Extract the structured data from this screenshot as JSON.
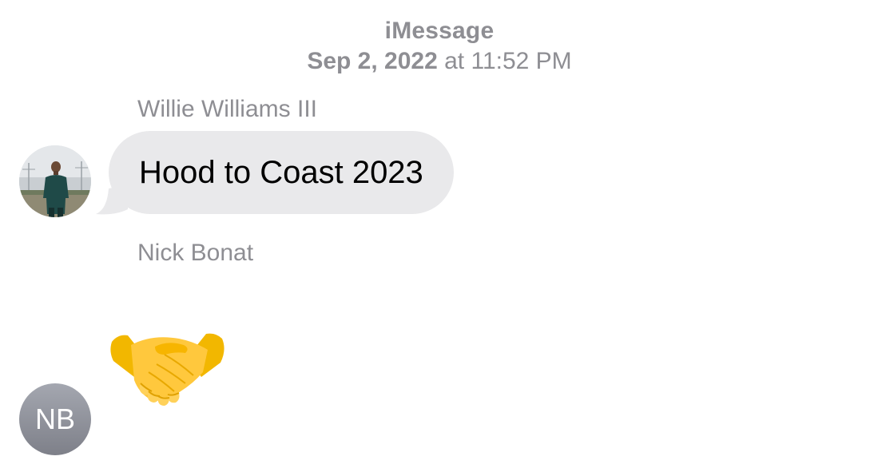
{
  "header": {
    "service": "iMessage",
    "date": "Sep 2, 2022",
    "at_word": "at",
    "time": "11:52 PM"
  },
  "messages": [
    {
      "sender": "Willie Williams III",
      "avatar_icon": "person-photo-avatar",
      "text": "Hood to Coast 2023",
      "bubble_color": "#e9e9eb"
    },
    {
      "sender": "Nick Bonat",
      "avatar_initials": "NB",
      "content_icon": "handshake-emoji"
    }
  ],
  "colors": {
    "meta_text": "#8e8e93",
    "bubble_received": "#e9e9eb",
    "initials_avatar": "#8e9099"
  }
}
